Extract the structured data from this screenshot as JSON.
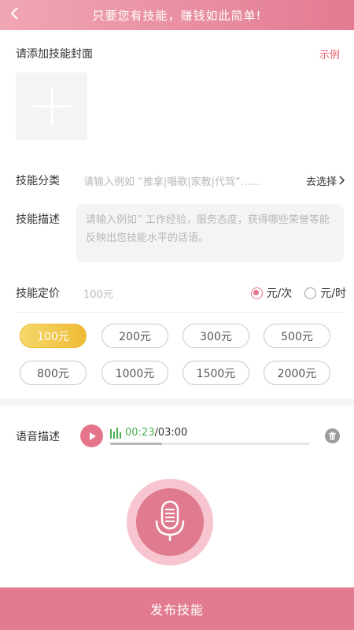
{
  "header": {
    "title": "只要您有技能，赚钱如此简单!",
    "back_icon": "chevron-left-icon"
  },
  "cover": {
    "label": "请添加技能封面",
    "example_label": "示例",
    "add_icon": "plus-icon"
  },
  "category": {
    "label": "技能分类",
    "placeholder": "请输入例如 “推拿|唱歌|家教|代驾”……",
    "choose_label": "去选择"
  },
  "description": {
    "label": "技能描述",
    "placeholder": "请输入例如” 工作经验，服务态度，获得哪些荣誉等能反映出您技能水平的话语。"
  },
  "price": {
    "label": "技能定价",
    "input_value": "100元",
    "units": [
      {
        "label": "元/次",
        "checked": true
      },
      {
        "label": "元/时",
        "checked": false
      }
    ],
    "presets": [
      "100元",
      "200元",
      "300元",
      "500元",
      "800元",
      "1000元",
      "1500元",
      "2000元"
    ],
    "selected_preset": "100元"
  },
  "voice": {
    "label": "语音描述",
    "current_time": "00:23",
    "total_time": "/03:00",
    "progress": 0.26
  },
  "footer": {
    "publish_label": "发布技能"
  },
  "colors": {
    "accent_pink": "#e27b8f",
    "gold": "#eebb35",
    "time_green": "#4caf50"
  }
}
